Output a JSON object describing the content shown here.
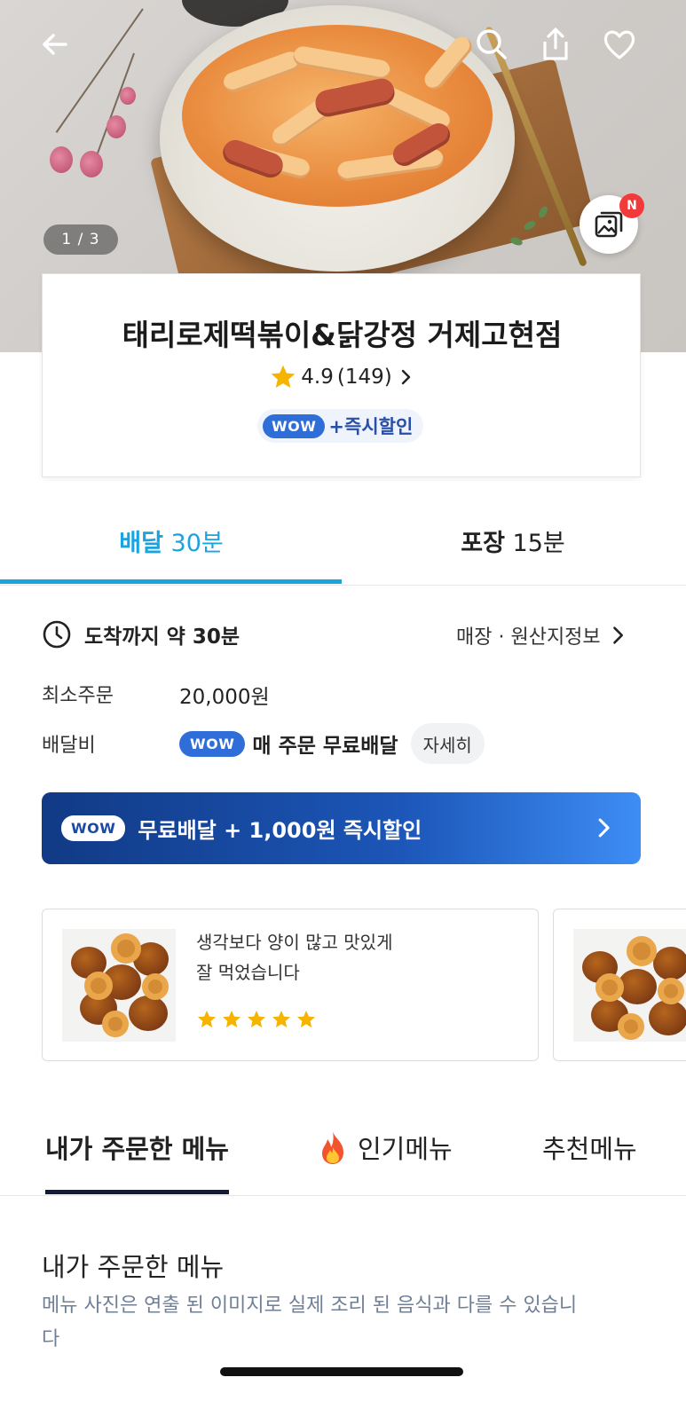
{
  "hero": {
    "photo_counter": "1 / 3",
    "new_badge": "N"
  },
  "store": {
    "name": "태리로제떡볶이&닭강정 거제고현점",
    "rating": "4.9",
    "review_count": "(149)",
    "wow_label": "WOW",
    "promo_text": "+즉시할인"
  },
  "mode_tabs": [
    {
      "label": "배달",
      "time": "30분",
      "active": true
    },
    {
      "label": "포장",
      "time": "15분",
      "active": false
    }
  ],
  "info": {
    "arrival_text": "도착까지 약 30분",
    "store_info_link": "매장 · 원산지정보",
    "min_order_label": "최소주문",
    "min_order_value": "20,000원",
    "delivery_fee_label": "배달비",
    "wow_label": "WOW",
    "delivery_fee_value": "매 주문 무료배달",
    "detail_button": "자세히"
  },
  "wow_banner": {
    "wow_label": "WOW",
    "text": "무료배달 + 1,000원 즉시할인"
  },
  "reviews": [
    {
      "line1": "생각보다 양이 많고 맛있게",
      "line2": "잘 먹었습니다",
      "stars": 5
    }
  ],
  "menu_tabs": [
    {
      "label": "내가 주문한 메뉴",
      "active": true
    },
    {
      "label": "인기메뉴",
      "icon": "fire-icon",
      "active": false
    },
    {
      "label": "추천메뉴",
      "active": false
    }
  ],
  "section": {
    "title": "내가 주문한 메뉴",
    "note": "메뉴 사진은 연출 된 이미지로 실제 조리 된 음식과 다를 수 있습니다"
  },
  "colors": {
    "accent_blue": "#1ba3e0",
    "wow_blue": "#2f6ed8",
    "star_yellow": "#f5b400",
    "badge_red": "#f23a3a",
    "menu_underline": "#121a3d"
  }
}
